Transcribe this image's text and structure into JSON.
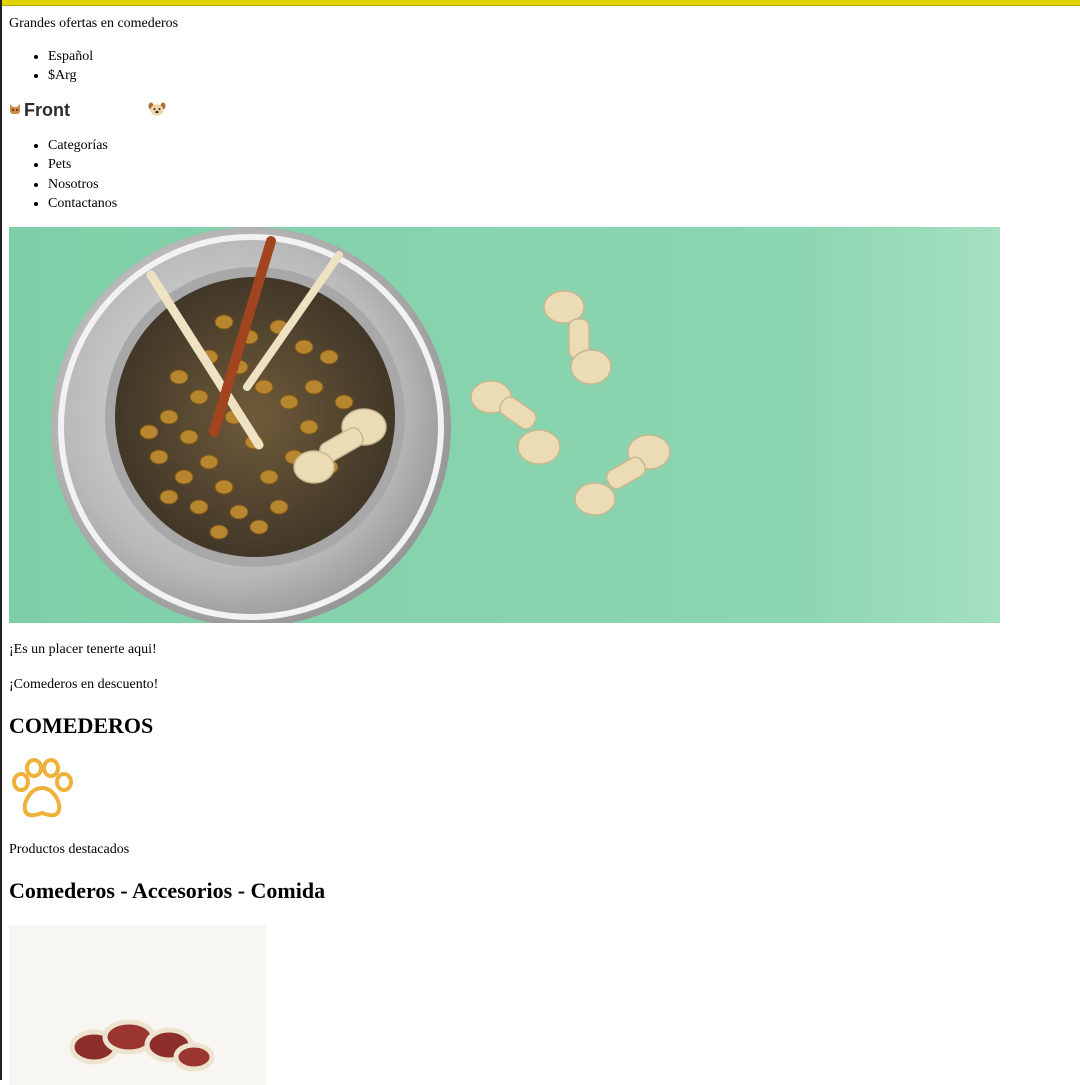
{
  "promo_banner": "Grandes ofertas en comederos",
  "meta": {
    "language": "Español",
    "currency": "$Arg"
  },
  "brand": {
    "name": "Front",
    "icon": "cat-face-icon",
    "pet_icon": "dog-face-icon"
  },
  "nav": {
    "items": [
      {
        "label": "Categorías"
      },
      {
        "label": "Pets"
      },
      {
        "label": "Nosotros"
      },
      {
        "label": "Contactanos"
      }
    ]
  },
  "hero": {
    "image": "pet-food-bowl-with-treats",
    "background_color": "#8fd4b0"
  },
  "welcome_text": "¡Es un placer tenerte aqui!",
  "discount_text": "¡Comederos en descuento!",
  "section_title": "COMEDEROS",
  "paw_icon": {
    "name": "paw-icon",
    "color": "#f0b13a"
  },
  "featured_label": "Productos destacados",
  "categories_title": "Comederos - Accesorios - Comida",
  "product": {
    "image": "dog-treat-bones"
  }
}
